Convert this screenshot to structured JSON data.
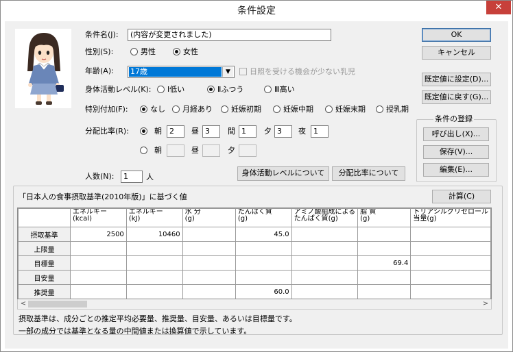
{
  "window": {
    "title": "条件設定",
    "close_glyph": "✕"
  },
  "form": {
    "name_label": "条件名(J):",
    "name_value": "(内容が変更されました)",
    "sex_label": "性別(S):",
    "sex_male": "男性",
    "sex_female": "女性",
    "age_label": "年齢(A):",
    "age_value": "17歳",
    "sunlight_label": "日照を受ける機会が少ない乳児",
    "activity_label": "身体活動レベル(K):",
    "activity_low": "Ⅰ低い",
    "activity_mid": "Ⅱふつう",
    "activity_high": "Ⅲ高い",
    "special_label": "特別付加(F):",
    "special_none": "なし",
    "special_menses": "月経あり",
    "special_preg_early": "妊娠初期",
    "special_preg_mid": "妊娠中期",
    "special_preg_late": "妊娠末期",
    "special_lactation": "授乳期",
    "ratio_label": "分配比率(R):",
    "ratio_row1": {
      "morning_label": "朝",
      "morning": "2",
      "noon_label": "昼",
      "noon": "3",
      "snack_label": "間",
      "snack": "1",
      "evening_label": "夕",
      "evening": "3",
      "night_label": "夜",
      "night": "1"
    },
    "ratio_row2": {
      "morning_label": "朝",
      "noon_label": "昼",
      "evening_label": "夕"
    },
    "people_label": "人数(N):",
    "people_value": "1",
    "people_unit": "人"
  },
  "buttons": {
    "ok": "OK",
    "cancel": "キャンセル",
    "set_default": "既定値に設定(D)...",
    "restore_default": "既定値に戻す(G)...",
    "activity_about": "身体活動レベルについて",
    "ratio_about": "分配比率について",
    "calc": "計算(C)"
  },
  "registration": {
    "title": "条件の登録",
    "load": "呼び出し(X)...",
    "save": "保存(V)...",
    "edit": "編集(E)..."
  },
  "table": {
    "caption": "「日本人の食事摂取基準(2010年版)」に基づく値",
    "columns": [
      [
        "エネルギー",
        "(kcal)"
      ],
      [
        "エネルギー",
        "(kJ)"
      ],
      [
        "水 分",
        "(g)"
      ],
      [
        "たんぱく質",
        "(g)"
      ],
      [
        "アミノ酸組成による",
        "たんぱく質(g)"
      ],
      [
        "脂 質",
        "(g)"
      ],
      [
        "トリアシルグリセロール",
        "当量(g)"
      ]
    ],
    "rows": [
      {
        "label": "摂取基準",
        "cells": [
          "2500",
          "10460",
          "",
          "45.0",
          "",
          "",
          ""
        ]
      },
      {
        "label": "上限量",
        "cells": [
          "",
          "",
          "",
          "",
          "",
          "",
          ""
        ]
      },
      {
        "label": "目標量",
        "cells": [
          "",
          "",
          "",
          "",
          "",
          "69.4",
          ""
        ]
      },
      {
        "label": "目安量",
        "cells": [
          "",
          "",
          "",
          "",
          "",
          "",
          ""
        ]
      },
      {
        "label": "推奨量",
        "cells": [
          "",
          "",
          "",
          "60.0",
          "",
          "",
          ""
        ]
      }
    ]
  },
  "footer": {
    "line1": "摂取基準は、成分ごとの推定平均必要量、推奨量、目安量、あるいは目標量です。",
    "line2": "一部の成分では基準となる量の中間値または換算値で示しています。"
  }
}
